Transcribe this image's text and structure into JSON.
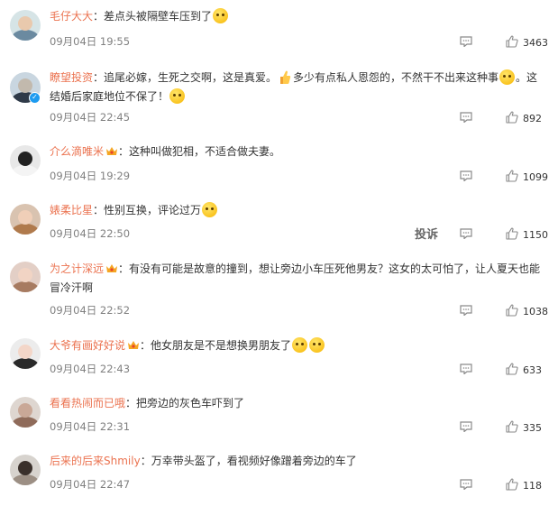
{
  "comments": [
    {
      "username": "毛仔大大",
      "crown": false,
      "verified": false,
      "segments": [
        {
          "t": "text",
          "v": "：差点头被隔壁车压到了"
        },
        {
          "t": "emoji",
          "v": "scared-face-emoji"
        }
      ],
      "date": "09月04日 19:55",
      "likes": "3463",
      "report": "",
      "avatar": {
        "bg": "#d6e4e6",
        "face": "#e9c9ad",
        "body": "#6b8aa0"
      }
    },
    {
      "username": "瞭望投资",
      "crown": false,
      "verified": true,
      "segments": [
        {
          "t": "text",
          "v": "：追尾必嫁，生死之交啊，这是真爱。"
        },
        {
          "t": "emoji",
          "v": "thumbs-up-emoji"
        },
        {
          "t": "text",
          "v": "多少有点私人恩怨的，不然干不出来这种事"
        },
        {
          "t": "emoji",
          "v": "laughing-tears-emoji"
        },
        {
          "t": "text",
          "v": "。这结婚后家庭地位不保了！"
        },
        {
          "t": "emoji",
          "v": "crying-face-emoji"
        }
      ],
      "date": "09月04日 22:45",
      "likes": "892",
      "report": "",
      "avatar": {
        "bg": "#c9d6e0",
        "face": "#c2b9ad",
        "body": "#2f3a48"
      }
    },
    {
      "username": "介么滴唯米",
      "crown": true,
      "verified": false,
      "segments": [
        {
          "t": "text",
          "v": "：这种叫做犯相，不适合做夫妻。"
        }
      ],
      "date": "09月04日 19:29",
      "likes": "1099",
      "report": "",
      "avatar": {
        "bg": "#e8e8e8",
        "face": "#222222",
        "body": "#f4f4f4"
      }
    },
    {
      "username": "婊柔比星",
      "crown": false,
      "verified": false,
      "segments": [
        {
          "t": "text",
          "v": "：性别互换，评论过万"
        },
        {
          "t": "emoji",
          "v": "laughing-face-emoji"
        }
      ],
      "date": "09月04日 22:50",
      "likes": "1150",
      "report": "投诉",
      "avatar": {
        "bg": "#d9c3b0",
        "face": "#f0cfb8",
        "body": "#b07a4c"
      }
    },
    {
      "username": "为之计深远",
      "crown": true,
      "verified": false,
      "segments": [
        {
          "t": "text",
          "v": "：有没有可能是故意的撞到，想让旁边小车压死他男友？这女的太可怕了，让人夏天也能冒冷汗啊"
        }
      ],
      "date": "09月04日 22:52",
      "likes": "1038",
      "report": "",
      "avatar": {
        "bg": "#e3cfc6",
        "face": "#f1d4c4",
        "body": "#a77b61"
      }
    },
    {
      "username": "大爷有画好好说",
      "crown": true,
      "verified": false,
      "segments": [
        {
          "t": "text",
          "v": "：他女朋友是不是想换男朋友了"
        },
        {
          "t": "emoji",
          "v": "laughing-tears-emoji"
        },
        {
          "t": "emoji",
          "v": "laughing-tears-emoji"
        }
      ],
      "date": "09月04日 22:43",
      "likes": "633",
      "report": "",
      "avatar": {
        "bg": "#ececec",
        "face": "#f3d6c8",
        "body": "#2a2a2a"
      }
    },
    {
      "username": "看看热闹而已哦",
      "crown": false,
      "verified": false,
      "segments": [
        {
          "t": "text",
          "v": "：把旁边的灰色车吓到了"
        }
      ],
      "date": "09月04日 22:31",
      "likes": "335",
      "report": "",
      "avatar": {
        "bg": "#ded6d0",
        "face": "#c9a897",
        "body": "#8f6b5a"
      }
    },
    {
      "username": "后来的后来Shmily",
      "crown": false,
      "verified": false,
      "segments": [
        {
          "t": "text",
          "v": "：万幸带头盔了，看视频好像蹭着旁边的车了"
        }
      ],
      "date": "09月04日 22:47",
      "likes": "118",
      "report": "",
      "avatar": {
        "bg": "#d7d3ce",
        "face": "#3a302b",
        "body": "#9c8f84"
      }
    }
  ]
}
